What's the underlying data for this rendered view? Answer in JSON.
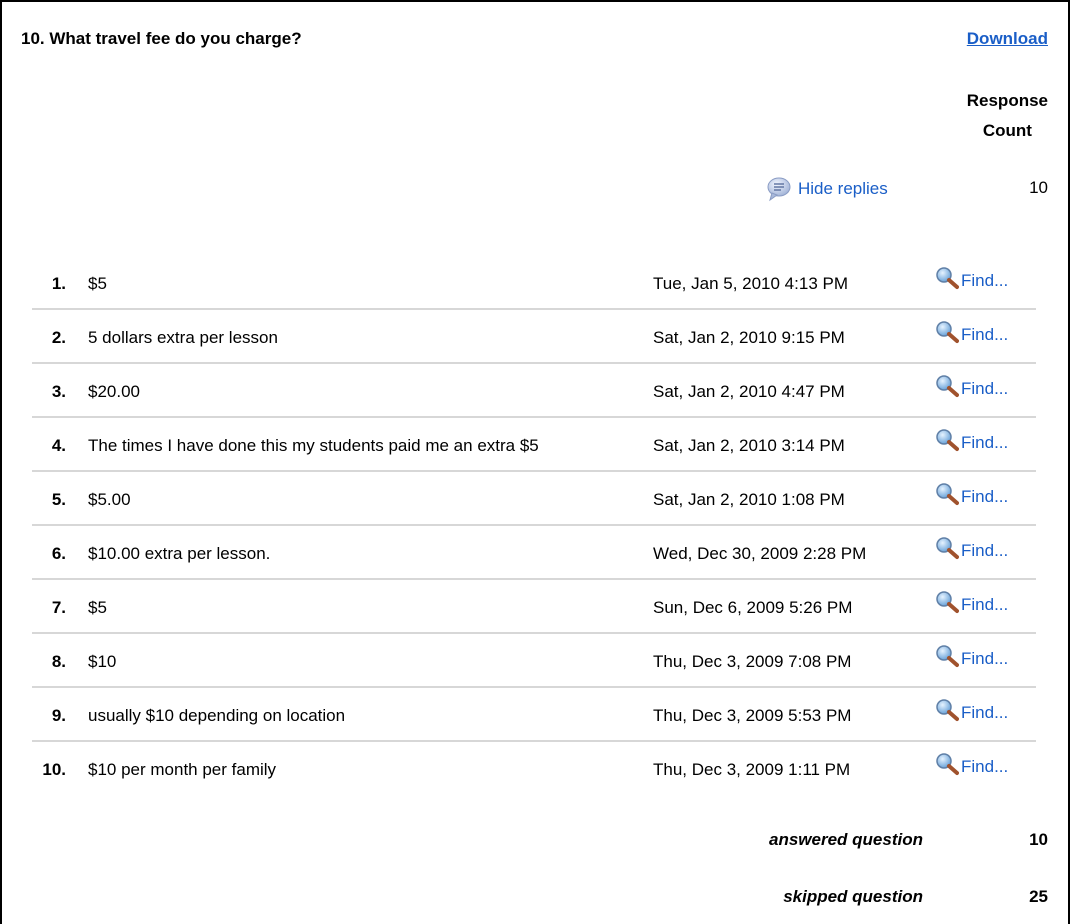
{
  "question": {
    "title": "10. What travel fee do you charge?",
    "download_label": "Download",
    "response_count_header": [
      "Response",
      "Count"
    ],
    "hide_replies_label": "Hide replies",
    "total_count": "10"
  },
  "responses": [
    {
      "num": "1.",
      "text": "$5",
      "date": "Tue, Jan 5, 2010 4:13 PM",
      "find": "Find..."
    },
    {
      "num": "2.",
      "text": "5 dollars extra per lesson",
      "date": "Sat, Jan 2, 2010 9:15 PM",
      "find": "Find..."
    },
    {
      "num": "3.",
      "text": "$20.00",
      "date": "Sat, Jan 2, 2010 4:47 PM",
      "find": "Find..."
    },
    {
      "num": "4.",
      "text": "The times I have done this my students paid me an extra $5",
      "date": "Sat, Jan 2, 2010 3:14 PM",
      "find": "Find..."
    },
    {
      "num": "5.",
      "text": "$5.00",
      "date": "Sat, Jan 2, 2010 1:08 PM",
      "find": "Find..."
    },
    {
      "num": "6.",
      "text": "$10.00 extra per lesson.",
      "date": "Wed, Dec 30, 2009 2:28 PM",
      "find": "Find..."
    },
    {
      "num": "7.",
      "text": "$5",
      "date": "Sun, Dec 6, 2009 5:26 PM",
      "find": "Find..."
    },
    {
      "num": "8.",
      "text": "$10",
      "date": "Thu, Dec 3, 2009 7:08 PM",
      "find": "Find..."
    },
    {
      "num": "9.",
      "text": "usually $10 depending on location",
      "date": "Thu, Dec 3, 2009 5:53 PM",
      "find": "Find..."
    },
    {
      "num": "10.",
      "text": "$10 per month per family",
      "date": "Thu, Dec 3, 2009 1:11 PM",
      "find": "Find..."
    }
  ],
  "summary": {
    "answered_label": "answered question",
    "answered_value": "10",
    "skipped_label": "skipped question",
    "skipped_value": "25"
  },
  "colors": {
    "link": "#1a5ec7",
    "divider": "#d7d7d7"
  },
  "icons": {
    "hide_replies": "speech-bubble-icon",
    "find": "magnifier-icon"
  }
}
